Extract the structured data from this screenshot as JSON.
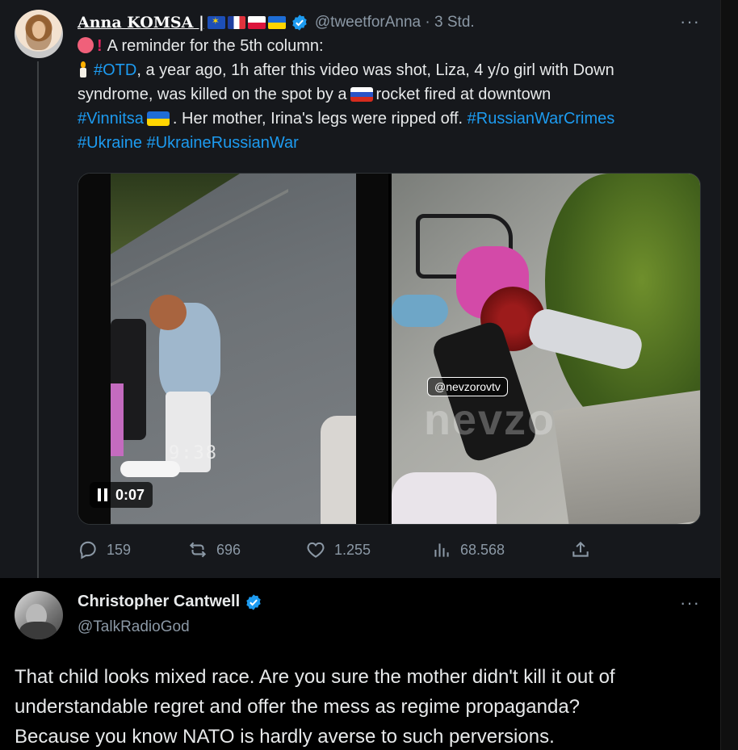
{
  "tweet1": {
    "author": {
      "display_name": "Anna KOMSA |",
      "flags": [
        "eu-flag",
        "france-flag",
        "poland-flag",
        "ukraine-flag"
      ],
      "verified": true,
      "handle": "@tweetforAnna",
      "separator": "·",
      "time": "3 Std."
    },
    "more": "···",
    "text": {
      "line1": "A reminder for the 5th column:",
      "line2_tag": "#OTD",
      "line2_rest": ", a year ago, 1h after this video was shot, Liza, 4 y/o girl with Down",
      "line3_a": "syndrome, was killed on the spot by a",
      "line3_b": "rocket fired at downtown",
      "line4_tag": "#Vinnitsa",
      "line4_rest": ". Her mother, Irina's legs were ripped off.",
      "line4_tag2": "#RussianWarCrimes",
      "line5_tag1": "#Ukraine",
      "line5_tag2": "#UkraineRussianWar"
    },
    "media": {
      "video_burned_timecode": "9:38",
      "video_time": "0:07",
      "photo_watermark_tag": "@nevzorovtv",
      "photo_watermark_big": "nevzo"
    },
    "actions": {
      "replies": "159",
      "reposts": "696",
      "likes": "1.255",
      "views": "68.568"
    }
  },
  "tweet2": {
    "author": {
      "display_name": "Christopher Cantwell",
      "verified": true,
      "handle": "@TalkRadioGod"
    },
    "more": "···",
    "text": {
      "line1": "That child looks mixed race. Are you sure the mother didn't kill it out of",
      "line2": "understandable regret and offer the mess as regime propaganda?",
      "line3": "Because you know NATO is hardly averse to such perversions."
    }
  },
  "colors": {
    "link": "#1d9bf0",
    "verified": "#1d9bf0",
    "muted": "#8b98a5",
    "text": "#e7e9ea",
    "tweet1_bg": "#16181c",
    "tweet2_bg": "#000000"
  }
}
